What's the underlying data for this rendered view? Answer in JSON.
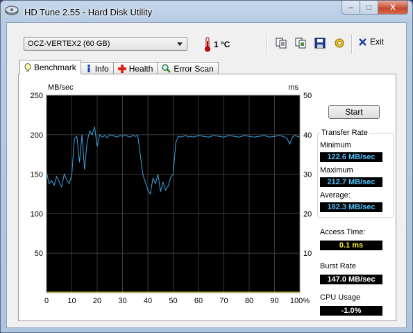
{
  "window": {
    "title": "HD Tune 2.55 - Hard Disk Utility",
    "caption_buttons": {
      "minimize": "–",
      "maximize": "□",
      "close": "X"
    }
  },
  "toolbar": {
    "drive": "OCZ-VERTEX2 (60 GB)",
    "temperature": "1 °C",
    "buttons": [
      "copy-text-icon",
      "copy-screenshot-icon",
      "save-icon",
      "options-icon"
    ],
    "exit_label": "Exit"
  },
  "tabs": [
    {
      "label": "Benchmark",
      "icon": "bulb-icon",
      "active": true
    },
    {
      "label": "Info",
      "icon": "info-icon",
      "active": false
    },
    {
      "label": "Health",
      "icon": "health-cross-icon",
      "active": false
    },
    {
      "label": "Error Scan",
      "icon": "magnifier-icon",
      "active": false
    }
  ],
  "benchmark": {
    "start_label": "Start",
    "transfer_rate_title": "Transfer Rate",
    "minimum_label": "Minimum",
    "minimum_value": "122.6 MB/sec",
    "maximum_label": "Maximum",
    "maximum_value": "212.7 MB/sec",
    "average_label": "Average:",
    "average_value": "182.3 MB/sec",
    "access_time_label": "Access Time:",
    "access_time_value": "0.1 ms",
    "burst_rate_label": "Burst Rate",
    "burst_rate_value": "147.0 MB/sec",
    "cpu_usage_label": "CPU Usage",
    "cpu_usage_value": "-1.0%"
  },
  "colors": {
    "plot_bg": "#000000",
    "grid": "#3a3a3a",
    "transfer_line": "#3aa6e6",
    "access_line": "#f2ea22",
    "value_blue": "#4fc3ff",
    "value_yellow": "#ffee33"
  },
  "chart_data": {
    "type": "line",
    "ylabel_left": "MB/sec",
    "ylabel_right": "ms",
    "x_ticks": [
      "0",
      "10",
      "20",
      "30",
      "40",
      "50",
      "60",
      "70",
      "80",
      "90",
      "100%"
    ],
    "y_left_ticks": [
      "250",
      "200",
      "150",
      "100",
      "50"
    ],
    "y_right_ticks": [
      "50",
      "40",
      "30",
      "20",
      "10"
    ],
    "xlim": [
      0,
      100
    ],
    "ylim_left": [
      0,
      250
    ],
    "ylim_right": [
      0,
      50
    ],
    "grid": true,
    "series": [
      {
        "name": "Transfer Rate",
        "axis": "left",
        "x": [
          0,
          1,
          2,
          3,
          4,
          5,
          6,
          7,
          8,
          9,
          10,
          11,
          12,
          13,
          14,
          15,
          16,
          17,
          18,
          19,
          20,
          21,
          22,
          23,
          24,
          25,
          26,
          27,
          28,
          29,
          30,
          31,
          32,
          33,
          34,
          35,
          36,
          37,
          38,
          39,
          40,
          41,
          42,
          43,
          44,
          45,
          46,
          47,
          48,
          49,
          50,
          51,
          52,
          53,
          54,
          55,
          56,
          57,
          58,
          59,
          60,
          62,
          64,
          66,
          68,
          70,
          72,
          74,
          76,
          78,
          80,
          82,
          84,
          86,
          88,
          90,
          92,
          94,
          95,
          96,
          97,
          98,
          99,
          100
        ],
        "values": [
          153,
          138,
          142,
          136,
          147,
          140,
          134,
          150,
          143,
          138,
          150,
          195,
          198,
          165,
          200,
          156,
          190,
          205,
          200,
          210,
          185,
          200,
          197,
          199,
          196,
          200,
          199,
          198,
          197,
          199,
          198,
          200,
          198,
          197,
          199,
          198,
          199,
          175,
          150,
          140,
          130,
          125,
          145,
          138,
          150,
          128,
          140,
          130,
          135,
          146,
          150,
          190,
          198,
          197,
          198,
          199,
          197,
          198,
          197,
          198,
          199,
          198,
          197,
          199,
          198,
          197,
          199,
          198,
          197,
          199,
          198,
          197,
          198,
          199,
          197,
          198,
          199,
          197,
          195,
          188,
          197,
          199,
          198,
          197
        ]
      },
      {
        "name": "Access Time",
        "axis": "right",
        "x": [
          0,
          100
        ],
        "values": [
          0.1,
          0.1
        ]
      }
    ]
  }
}
